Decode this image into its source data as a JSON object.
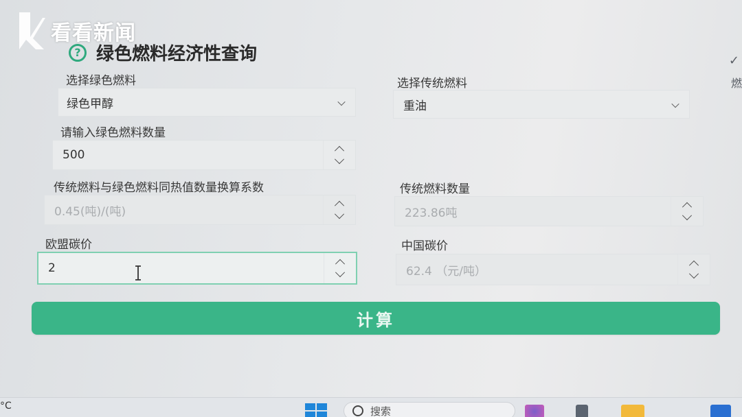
{
  "watermark": {
    "text": "看看新闻"
  },
  "header": {
    "title": "绿色燃料经济性查询",
    "help_glyph": "?"
  },
  "edge": {
    "glyph_top": "✓",
    "glyph_side": "燃"
  },
  "form": {
    "green_fuel": {
      "label": "选择绿色燃料",
      "value": "绿色甲醇"
    },
    "traditional_fuel": {
      "label": "选择传统燃料",
      "value": "重油"
    },
    "green_qty": {
      "label": "请输入绿色燃料数量",
      "value": "500"
    },
    "conversion": {
      "label": "传统燃料与绿色燃料同热值数量换算系数",
      "value": "0.45(吨)/(吨)"
    },
    "traditional_qty": {
      "label": "传统燃料数量",
      "value": "223.86吨"
    },
    "eu_carbon": {
      "label": "欧盟碳价",
      "value": "2"
    },
    "cn_carbon": {
      "label": "中国碳价",
      "value": "62.4 （元/吨）"
    }
  },
  "actions": {
    "calculate": "计算"
  },
  "taskbar": {
    "temp_suffix": "°C",
    "search_placeholder": "搜索"
  },
  "colors": {
    "accent": "#3ab588",
    "help": "#2fa97e"
  }
}
